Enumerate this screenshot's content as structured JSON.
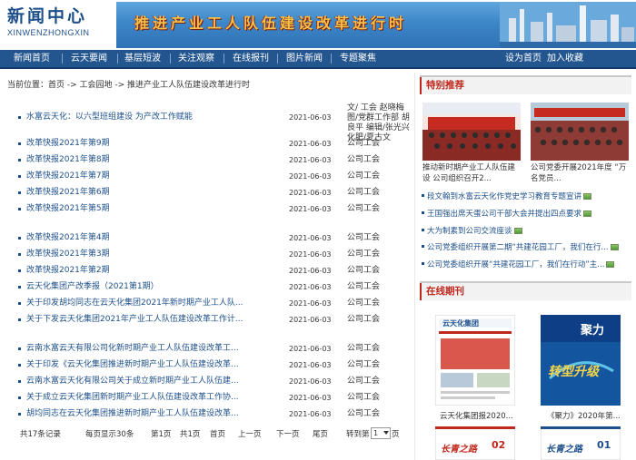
{
  "header": {
    "logo_cn": "新闻中心",
    "logo_en": "XINWENZHONGXIN",
    "slogan": "推进产业工人队伍建设改革进行时"
  },
  "nav": {
    "items": [
      "新闻首页",
      "云天要闻",
      "基层短波",
      "关注观察",
      "在线报刊",
      "图片新闻",
      "专题聚焦"
    ],
    "right": [
      "设为首页",
      "加入收藏"
    ]
  },
  "breadcrumb": "当前位置：首页 -> 工会园地 -> 推进产业工人队伍建设改革进行时",
  "articles": [
    {
      "title": "水富云天化：以六型班组建设 为产改工作赋能",
      "date": "2021-06-03",
      "source": "文/ 工会 赵晓梅 图/党群工作部 胡良平 编辑/张光兴 化肥/夏古文"
    },
    {
      "title": "改革快报2021年第9期",
      "date": "2021-06-03",
      "source": "公司工会"
    },
    {
      "title": "改革快报2021年第8期",
      "date": "2021-06-03",
      "source": "公司工会"
    },
    {
      "title": "改革快报2021年第7期",
      "date": "2021-06-03",
      "source": "公司工会"
    },
    {
      "title": "改革快报2021年第6期",
      "date": "2021-06-03",
      "source": "公司工会"
    },
    {
      "title": "改革快报2021年第5期",
      "date": "2021-06-03",
      "source": "公司工会"
    },
    {
      "title": "改革快报2021年第4期",
      "date": "2021-06-03",
      "source": "公司工会"
    },
    {
      "title": "改革快报2021年第3期",
      "date": "2021-06-03",
      "source": "公司工会"
    },
    {
      "title": "改革快报2021年第2期",
      "date": "2021-06-03",
      "source": "公司工会"
    },
    {
      "title": "云天化集团产改季报（2021第1期）",
      "date": "2021-06-03",
      "source": "公司工会"
    },
    {
      "title": "关于印发胡均同志在云天化集团2021年新时期产业工人队...",
      "date": "2021-06-03",
      "source": "公司工会"
    },
    {
      "title": "关于下发云天化集团2021年产业工人队伍建设改革工作计...",
      "date": "2021-06-03",
      "source": "公司工会"
    },
    {
      "title": "云南水富云天有限公司化新时期产业工人队伍建设改革工...",
      "date": "2021-06-03",
      "source": "公司工会"
    },
    {
      "title": "关于印发《云天化集团推进新时期产业工人队伍建设改革...",
      "date": "2021-06-03",
      "source": "公司工会"
    },
    {
      "title": "云南水富云天化有限公司关于成立新时期产业工人队伍建...",
      "date": "2021-06-03",
      "source": "公司工会"
    },
    {
      "title": "关于成立云天化集团新时期产业工人队伍建设改革工作协...",
      "date": "2021-06-03",
      "source": "公司工会"
    },
    {
      "title": "胡均同志在云天化集团推进新时期产业工人队伍建设改革...",
      "date": "2021-06-03",
      "source": "公司工会"
    }
  ],
  "pager": {
    "total": "共17条记录",
    "per_page": "每页显示30条",
    "current": "第1页",
    "pages": "共1页",
    "first": "首页",
    "prev": "上一页",
    "next": "下一页",
    "last": "尾页",
    "goto_prefix": "转到第",
    "goto_value": "1",
    "goto_suffix": "页"
  },
  "special": {
    "title": "特别推荐",
    "photos": [
      {
        "caption": "推动新时期产业工人队伍建设 公司组织召开2..."
      },
      {
        "caption": "公司党委开展2021年度 “万名党员..."
      }
    ],
    "items": [
      "段文翰到水富云天化作党史学习教育专题宣讲",
      "王国强出席天蛋公司干部大会并提出四点要求",
      "大为制素到公司交流座谈",
      "公司党委组织开展第二期“共建花园工厂，我们在行...",
      "公司党委组织开展“共建花园工厂，我们在行动”主..."
    ]
  },
  "online": {
    "title": "在线期刊",
    "mags": [
      {
        "caption": "云天化集团报2020...",
        "masthead": "云天化集团"
      },
      {
        "caption": "《聚力》2020年第...",
        "masthead": "聚力",
        "cover_text": "转型升级"
      },
      {
        "masthead": "长青之路",
        "issue": "02"
      },
      {
        "masthead": "长青之路",
        "issue": "01"
      }
    ]
  },
  "colors": {
    "nav_bg": "#23568f",
    "accent_red": "#c0281c",
    "link_blue": "#1d4f8a"
  }
}
